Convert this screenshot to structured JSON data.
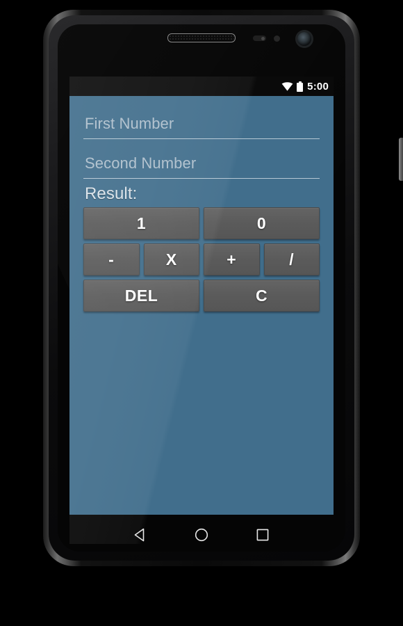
{
  "device": {
    "name": "android-phone",
    "hardware": {
      "earpiece": "earpiece-speaker",
      "proximity_sensor": "proximity-sensor",
      "light_sensor": "light-sensor",
      "front_camera": "front-camera",
      "power_button": "power-button",
      "volume_rocker": "volume-rocker"
    }
  },
  "statusbar": {
    "wifi_icon": "wifi-icon",
    "battery_icon": "battery-icon",
    "time": "5:00"
  },
  "app": {
    "title": "calculator",
    "background_color": "#416e8c",
    "button_color": "#5c5c5c",
    "fields": [
      {
        "name": "first-number",
        "value": "",
        "placeholder": "First Number"
      },
      {
        "name": "second-number",
        "value": "",
        "placeholder": "Second Number"
      }
    ],
    "result": {
      "label": "Result:",
      "value": ""
    },
    "rows": [
      {
        "name": "digit-row",
        "buttons": [
          {
            "name": "button-1",
            "label": "1"
          },
          {
            "name": "button-0",
            "label": "0"
          }
        ]
      },
      {
        "name": "operator-row",
        "buttons": [
          {
            "name": "button-minus",
            "label": "-"
          },
          {
            "name": "button-multiply",
            "label": "X"
          },
          {
            "name": "button-plus",
            "label": "+"
          },
          {
            "name": "button-divide",
            "label": "/"
          }
        ]
      },
      {
        "name": "action-row",
        "buttons": [
          {
            "name": "button-delete",
            "label": "DEL"
          },
          {
            "name": "button-clear",
            "label": "C"
          }
        ]
      }
    ]
  },
  "navbar": {
    "back": "back-icon",
    "home": "home-icon",
    "recents": "recents-icon"
  }
}
